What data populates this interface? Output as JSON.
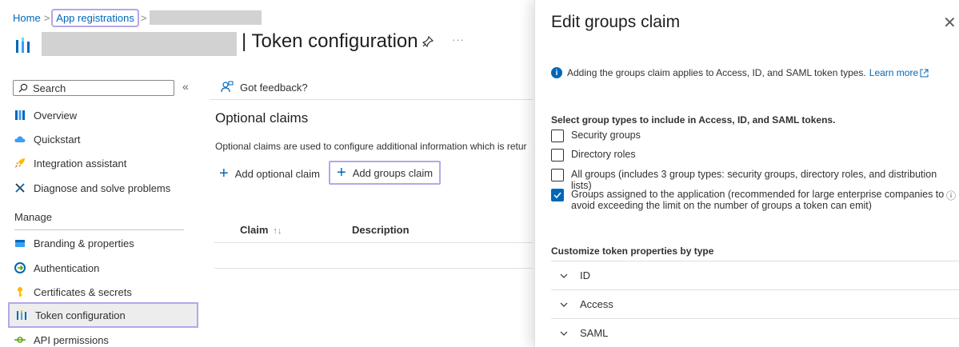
{
  "breadcrumb": {
    "home": "Home",
    "sep": ">",
    "app_registrations": "App registrations"
  },
  "header": {
    "title": "| Token configuration",
    "more": "···"
  },
  "sidebar": {
    "search_placeholder": "Search",
    "collapse": "«",
    "items": [
      {
        "label": "Overview",
        "icon": "overview-icon"
      },
      {
        "label": "Quickstart",
        "icon": "quickstart-cloud-icon"
      },
      {
        "label": "Integration assistant",
        "icon": "rocket-icon"
      },
      {
        "label": "Diagnose and solve problems",
        "icon": "wrench-icon"
      }
    ],
    "section_manage": "Manage",
    "manage_items": [
      {
        "label": "Branding & properties",
        "icon": "branding-icon"
      },
      {
        "label": "Authentication",
        "icon": "authentication-icon"
      },
      {
        "label": "Certificates & secrets",
        "icon": "key-icon"
      },
      {
        "label": "Token configuration",
        "icon": "token-bars-icon",
        "active": true
      },
      {
        "label": "API permissions",
        "icon": "api-permissions-icon"
      }
    ]
  },
  "content": {
    "feedback": "Got feedback?",
    "section_title": "Optional claims",
    "section_desc": "Optional claims are used to configure additional information which is retur",
    "add_optional": "Add optional claim",
    "add_groups": "Add groups claim",
    "columns": {
      "claim": "Claim",
      "sort": "↑↓",
      "description": "Description"
    }
  },
  "panel": {
    "title": "Edit groups claim",
    "close": "✕",
    "info_text": "Adding the groups claim applies to Access, ID, and SAML token types.",
    "learn_more": "Learn more",
    "group_types_title": "Select group types to include in Access, ID, and SAML tokens.",
    "options": [
      {
        "label": "Security groups",
        "checked": false
      },
      {
        "label": "Directory roles",
        "checked": false
      },
      {
        "label": "All groups (includes 3 group types: security groups, directory roles, and distribution lists)",
        "checked": false
      },
      {
        "label": "Groups assigned to the application (recommended for large enterprise companies to avoid exceeding the limit on the number of groups a token can emit)",
        "checked": true
      }
    ],
    "token_props_title": "Customize token properties by type",
    "token_types": [
      "ID",
      "Access",
      "SAML"
    ]
  },
  "colors": {
    "accent": "#0067b8",
    "highlight": "#b4a7e8"
  }
}
